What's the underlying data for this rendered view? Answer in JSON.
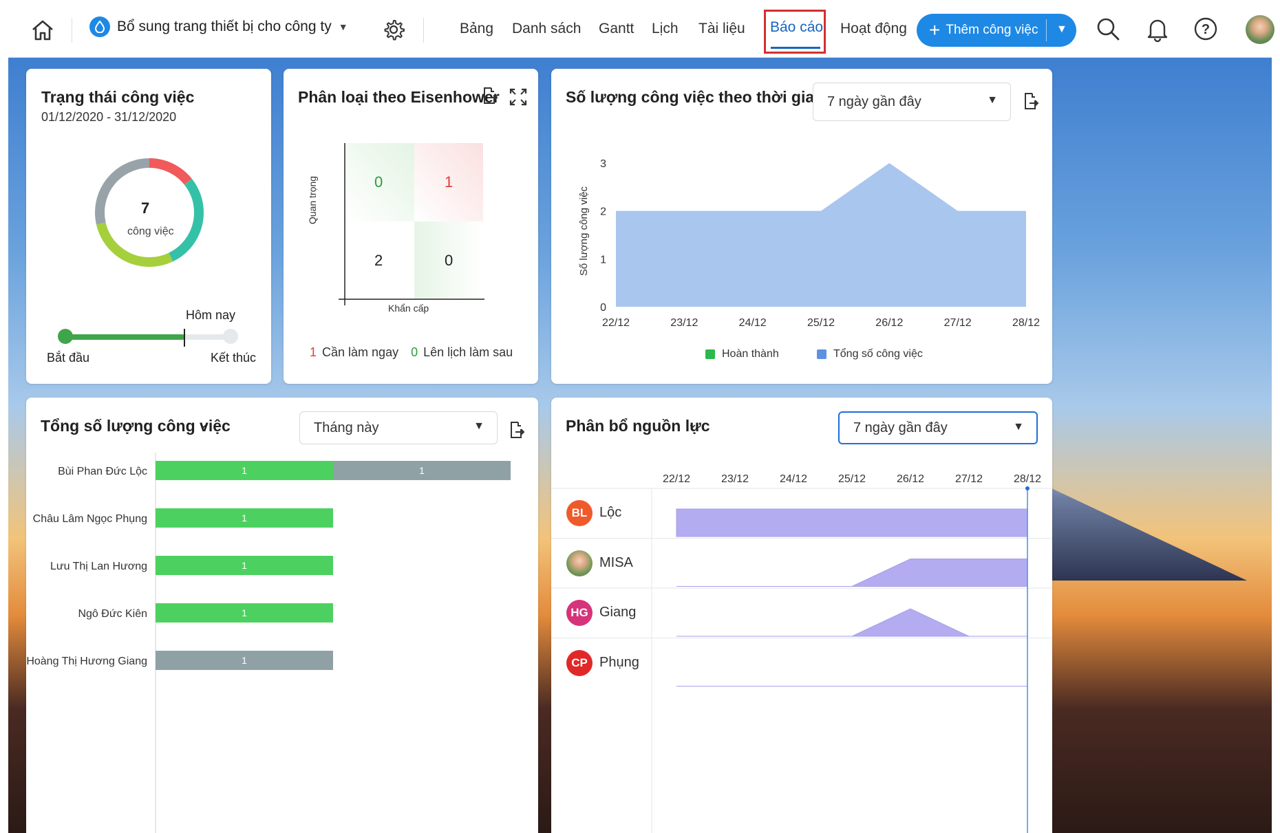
{
  "topbar": {
    "project_name": "Bổ sung trang thiết bị cho công ty",
    "tabs": [
      "Bảng",
      "Danh sách",
      "Gantt",
      "Lịch",
      "Tài liệu",
      "Báo cáo",
      "Hoạt động"
    ],
    "active_tab": "Báo cáo",
    "add_button_label": "Thêm công việc",
    "icons": [
      "home-icon",
      "water-drop-icon",
      "gear-icon",
      "search-icon",
      "bell-icon",
      "help-icon",
      "avatar"
    ]
  },
  "status_card": {
    "title": "Trạng thái công việc",
    "date_range": "01/12/2020 - 31/12/2020",
    "total": "7",
    "total_label": "công việc",
    "today_label": "Hôm nay",
    "start_label": "Bắt đầu",
    "end_label": "Kết thúc",
    "progress_fraction": 0.7,
    "donut_segments": [
      {
        "color": "#f05a5a",
        "value": 1
      },
      {
        "color": "#35c1a8",
        "value": 2
      },
      {
        "color": "#a6cf3c",
        "value": 2
      },
      {
        "color": "#98a3a9",
        "value": 2
      }
    ]
  },
  "eisenhower_card": {
    "title": "Phân loại theo Eisenhower",
    "y_label": "Quan trọng",
    "x_label": "Khẩn cấp",
    "cells": [
      "0",
      "1",
      "2",
      "0"
    ],
    "legend": [
      {
        "value": "1",
        "label": "Cần làm ngay",
        "color": "#e53935"
      },
      {
        "value": "0",
        "label": "Lên lịch làm sau",
        "color": "#2e9b3a"
      }
    ]
  },
  "timeline_card": {
    "title": "Số lượng công việc theo thời gian",
    "period": "7 ngày gần đây",
    "y_label": "Số lượng công việc",
    "legend": [
      {
        "label": "Hoàn thành",
        "color": "#2db84b"
      },
      {
        "label": "Tổng số công việc",
        "color": "#5c93e0"
      }
    ]
  },
  "total_card": {
    "title": "Tổng số lượng công việc",
    "period": "Tháng này"
  },
  "resource_card": {
    "title": "Phân bổ nguồn lực",
    "period": "7 ngày gần đây",
    "dates": [
      "22/12",
      "23/12",
      "24/12",
      "25/12",
      "26/12",
      "27/12",
      "28/12"
    ],
    "today_date": "28/12",
    "people": [
      {
        "initials": "BL",
        "name": "Lộc",
        "color": "#ef5a2b"
      },
      {
        "initials": "",
        "name": "MISA",
        "color": "#7a9a5a"
      },
      {
        "initials": "HG",
        "name": "Giang",
        "color": "#d6337a"
      },
      {
        "initials": "CP",
        "name": "Phụng",
        "color": "#e02828"
      }
    ]
  },
  "chart_data": [
    {
      "type": "area",
      "title": "Số lượng công việc theo thời gian",
      "x": [
        "22/12",
        "23/12",
        "24/12",
        "25/12",
        "26/12",
        "27/12",
        "28/12"
      ],
      "ylabel": "Số lượng công việc",
      "ylim": [
        0,
        3
      ],
      "yticks": [
        0,
        1,
        2,
        3
      ],
      "series": [
        {
          "name": "Tổng số công việc",
          "values": [
            2,
            2,
            2,
            2,
            3,
            2,
            2
          ],
          "color": "#a9c6ee"
        },
        {
          "name": "Hoàn thành",
          "values": [
            0,
            0,
            0,
            0,
            0,
            0,
            0
          ],
          "color": "#2db84b"
        }
      ],
      "legend": "bottom"
    },
    {
      "type": "bar",
      "orientation": "horizontal",
      "stacked": true,
      "categories": [
        "Bùi Phan Đức Lộc",
        "Châu Lâm Ngọc Phụng",
        "Lưu Thị Lan Hương",
        "Ngô Đức Kiên",
        "Hoàng Thị Hương Giang"
      ],
      "series": [
        {
          "values": [
            1,
            1,
            1,
            1,
            0
          ],
          "color": "#4cd160"
        },
        {
          "values": [
            1,
            0,
            0,
            0,
            1
          ],
          "color": "#90a1a6"
        }
      ],
      "xlim": [
        0,
        2
      ]
    },
    {
      "type": "area",
      "title": "Phân bổ nguồn lực",
      "x": [
        "22/12",
        "23/12",
        "24/12",
        "25/12",
        "26/12",
        "27/12",
        "28/12"
      ],
      "series": [
        {
          "name": "Lộc",
          "values": [
            1,
            1,
            1,
            1,
            1,
            1,
            1
          ]
        },
        {
          "name": "MISA",
          "values": [
            0,
            0,
            0,
            0,
            1,
            1,
            1
          ]
        },
        {
          "name": "Giang",
          "values": [
            0,
            0,
            0,
            0,
            1,
            0,
            0
          ]
        },
        {
          "name": "Phụng",
          "values": [
            0,
            0,
            0,
            0,
            0,
            0,
            0
          ]
        }
      ],
      "color": "#b3acf0"
    }
  ]
}
